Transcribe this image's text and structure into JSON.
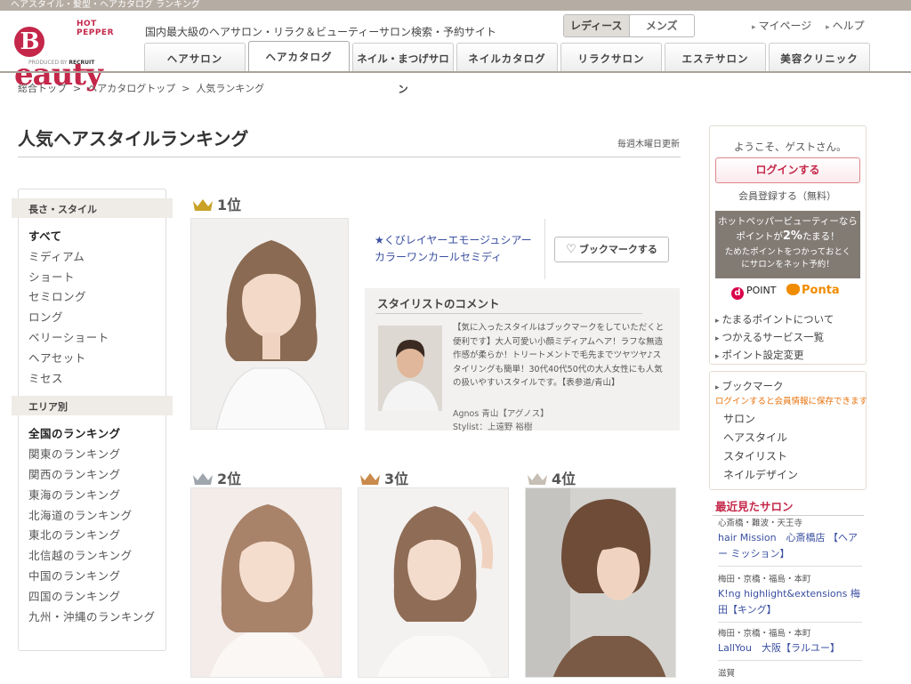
{
  "topstrip": "ヘアスタイル・髪型・ヘアカタログ ランキング",
  "brand": {
    "top": "HOT PEPPER",
    "name": "eauty",
    "initial": "B",
    "produced_prefix": "PRODUCED BY",
    "produced_by": "RECRUIT"
  },
  "tagline": "国内最大級のヘアサロン・リラク＆ビューティーサロン検索・予約サイト",
  "gender": {
    "ladies": "レディース",
    "mens": "メンズ"
  },
  "top_links": {
    "mypage": "マイページ",
    "help": "ヘルプ"
  },
  "tabs": [
    "ヘアサロン",
    "ヘアカタログ",
    "ネイル・まつげサロン",
    "ネイルカタログ",
    "リラクサロン",
    "エステサロン",
    "美容クリニック"
  ],
  "breadcrumb": {
    "c1": "総合トップ",
    "c2": "ヘアカタログトップ",
    "c3": "人気ランキング",
    "sep": ">"
  },
  "page_title": "人気ヘアスタイルランキング",
  "updated": "毎週木曜日更新",
  "left_nav": {
    "section1": "長さ・スタイル",
    "styles": [
      "すべて",
      "ミディアム",
      "ショート",
      "セミロング",
      "ロング",
      "ベリーショート",
      "ヘアセット",
      "ミセス"
    ],
    "section2": "エリア別",
    "areas": [
      "全国のランキング",
      "関東のランキング",
      "関西のランキング",
      "東海のランキング",
      "北海道のランキング",
      "東北のランキング",
      "北信越のランキング",
      "中国のランキング",
      "四国のランキング",
      "九州・沖縄のランキング"
    ]
  },
  "ranking": {
    "first": {
      "rank": "1位",
      "title": "★くびレイヤーエモージュシアーカラーワンカールセミディ",
      "bookmark": "ブックマークする"
    },
    "second": {
      "rank": "2位"
    },
    "third": {
      "rank": "3位"
    },
    "fourth": {
      "rank": "4位"
    }
  },
  "comment": {
    "heading": "スタイリストのコメント",
    "text": "【気に入ったスタイルはブックマークをしていただくと便利です】大人可愛い小顔ミディアムヘア！ラフな無造作感が柔らか！トリートメントで毛先までツヤツヤ♪スタイリングも簡単！30代40代50代の大人女性にも人気の扱いやすいスタイルです。【表参道/青山】",
    "salon": "Agnos 青山【アグノス】",
    "stylist": "Stylist：上遠野 裕樹"
  },
  "sidebar": {
    "welcome": "ようこそ、ゲストさん。",
    "login": "ログインする",
    "register": "会員登録する（無料）",
    "promo_line1": "ホットペッパービューティーなら",
    "promo_line2a": "ポイントが",
    "promo_line2b": "2%",
    "promo_line2c": "たまる！",
    "promo_line3": "ためたポイントをつかっておとく",
    "promo_line4": "にサロンをネット予約！",
    "dpoint": "POINT",
    "ponta": "Ponta",
    "links": [
      "たまるポイントについて",
      "つかえるサービス一覧",
      "ポイント設定変更"
    ],
    "bookmark_title": "ブックマーク",
    "bookmark_note": "ログインすると会員情報に保存できます",
    "bookmark_items": [
      "サロン",
      "ヘアスタイル",
      "スタイリスト",
      "ネイルデザイン"
    ],
    "recent_title": "最近見たサロン",
    "recent": [
      {
        "area": "心斎橋・難波・天王寺",
        "name": "hair Mission　心斎橋店 【ヘアー ミッション】"
      },
      {
        "area": "梅田・京橋・福島・本町",
        "name": "K!ng highlight&extensions 梅田【キング】"
      },
      {
        "area": "梅田・京橋・福島・本町",
        "name": "LallYou　大阪【ラルユー】"
      },
      {
        "area": "滋賀",
        "name": ""
      }
    ]
  },
  "colors": {
    "brand": "#c4274a",
    "gold": "#c9a227",
    "silver": "#a0a6ae",
    "bronze": "#c98a4b",
    "fourth": "#c7bfb6",
    "link": "#3a4fa0"
  }
}
